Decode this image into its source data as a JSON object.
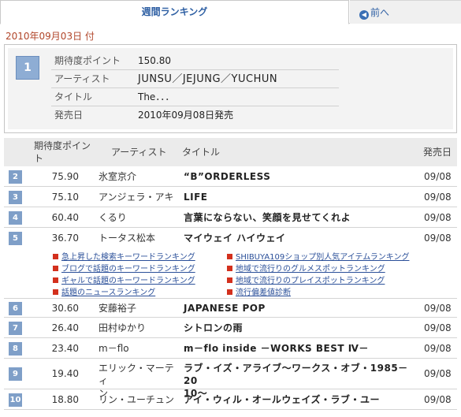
{
  "tabs": {
    "active": "週間ランキング",
    "back": "前へ"
  },
  "date": "2010年09月03日 付",
  "feature": {
    "rank": "1",
    "rows": [
      {
        "label": "期待度ポイント",
        "value": "150.80"
      },
      {
        "label": "アーティスト",
        "value": "JUNSU／JEJUNG／YUCHUN"
      },
      {
        "label": "タイトル",
        "value": "The．．．"
      },
      {
        "label": "発売日",
        "value": "2010年09月08日発売"
      }
    ]
  },
  "table": {
    "headers": {
      "points": "期待度ポイント",
      "artist": "アーティスト",
      "title": "タイトル",
      "release": "発売日"
    },
    "rows": [
      {
        "rank": "2",
        "points": "75.90",
        "artist": "氷室京介",
        "title": "“B”ORDERLESS",
        "release": "09/08"
      },
      {
        "rank": "3",
        "points": "75.10",
        "artist": "アンジェラ・アキ",
        "title": "LIFE",
        "release": "09/08"
      },
      {
        "rank": "4",
        "points": "60.40",
        "artist": "くるり",
        "title": "言葉にならない、笑顔を見せてくれよ",
        "release": "09/08"
      },
      {
        "rank": "5",
        "points": "36.70",
        "artist": "トータス松本",
        "title": "マイウェイ ハイウェイ",
        "release": "09/08"
      },
      {
        "rank": "6",
        "points": "30.60",
        "artist": "安藤裕子",
        "title": "JAPANESE POP",
        "release": "09/08"
      },
      {
        "rank": "7",
        "points": "26.40",
        "artist": "田村ゆかり",
        "title": "シトロンの雨",
        "release": "09/08"
      },
      {
        "rank": "8",
        "points": "23.40",
        "artist": "m－flo",
        "title": "m－flo inside －WORKS BEST Ⅳ－",
        "release": "09/08"
      },
      {
        "rank": "9",
        "points": "19.40",
        "artist_line1": "エリック・マーティ",
        "artist_line2": "ン",
        "title_line1": "ラブ・イズ・アライブ～ワークス・オブ・1985－20",
        "title_line2": "10～",
        "release": "09/08"
      },
      {
        "rank": "10",
        "points": "18.80",
        "artist": "リン・ユーチュン",
        "title": "アイ・ウィル・オールウェイズ・ラブ・ユー",
        "release": "09/08"
      }
    ]
  },
  "links": [
    "急上昇した検索キーワードランキング",
    "SHIBUYA109ショップ別人気アイテムランキング",
    "ブログで話題のキーワードランキング",
    "地域で流行りのグルメスポットランキング",
    "ギャルで話題のキーワードランキング",
    "地域で流行りのプレイスポットランキング",
    "話題のニュースランキング",
    "流行偏差値診断"
  ],
  "colors": {
    "accent": "#2e5fa3",
    "date": "#b1462a",
    "rank_badge": "#7f9fc8",
    "link_icon": "#d3301d"
  }
}
